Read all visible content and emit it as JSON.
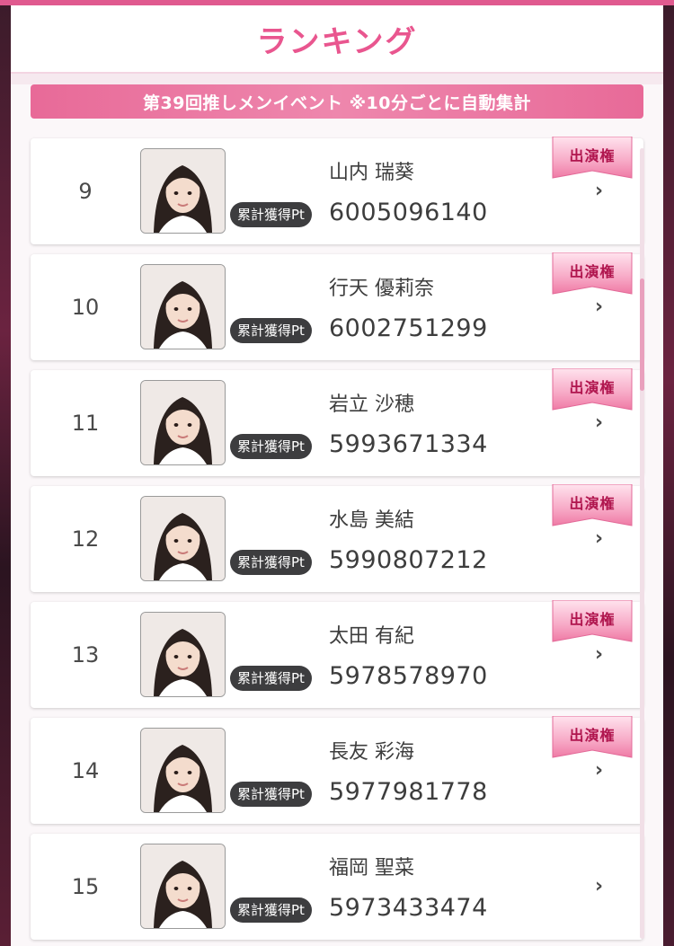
{
  "header": {
    "title": "ランキング"
  },
  "event": {
    "banner": "第39回推しメンイベント ※10分ごとに自動集計"
  },
  "pt_label": "累計獲得Pt",
  "appearance_badge": "出演権",
  "chevron": "›",
  "rankings": [
    {
      "rank": "9",
      "name": "山内 瑞葵",
      "points": "6005096140",
      "badge": true
    },
    {
      "rank": "10",
      "name": "行天 優莉奈",
      "points": "6002751299",
      "badge": true
    },
    {
      "rank": "11",
      "name": "岩立 沙穂",
      "points": "5993671334",
      "badge": true
    },
    {
      "rank": "12",
      "name": "水島 美結",
      "points": "5990807212",
      "badge": true
    },
    {
      "rank": "13",
      "name": "太田 有紀",
      "points": "5978578970",
      "badge": true
    },
    {
      "rank": "14",
      "name": "長友 彩海",
      "points": "5977981778",
      "badge": true
    },
    {
      "rank": "15",
      "name": "福岡 聖菜",
      "points": "5973433474",
      "badge": false
    }
  ],
  "colors": {
    "accent": "#e9568f",
    "banner": "#e86a98",
    "badge_text": "#b0154e",
    "pill": "#3d3d3f"
  }
}
